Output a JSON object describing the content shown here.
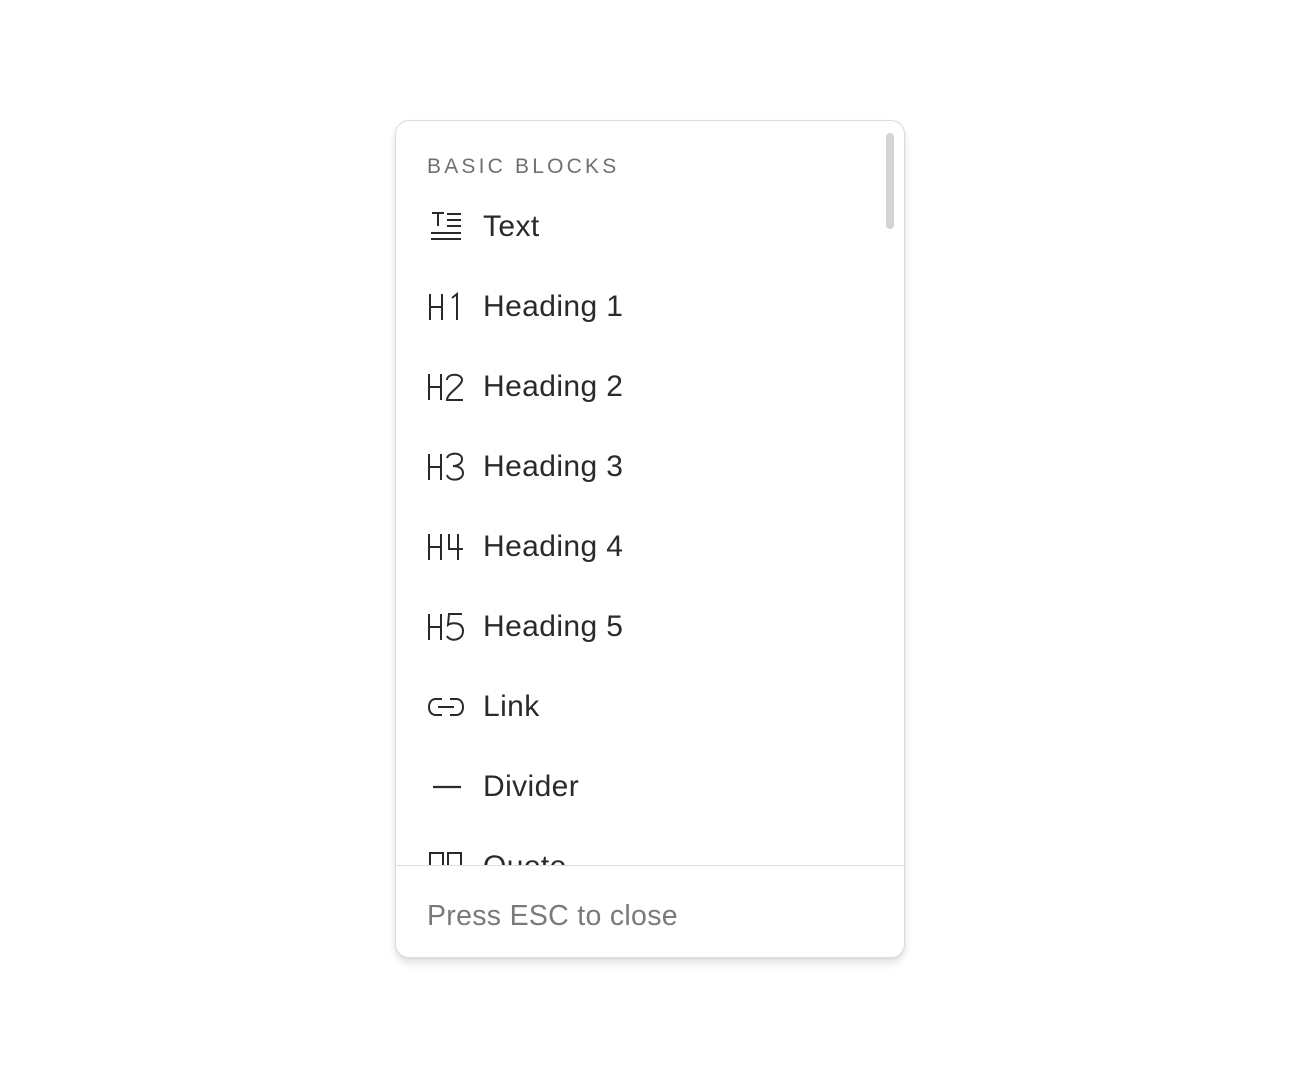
{
  "menu": {
    "section_header": "BASIC BLOCKS",
    "items": [
      {
        "label": "Text",
        "icon": "text-icon"
      },
      {
        "label": "Heading 1",
        "icon": "heading-1-icon"
      },
      {
        "label": "Heading 2",
        "icon": "heading-2-icon"
      },
      {
        "label": "Heading 3",
        "icon": "heading-3-icon"
      },
      {
        "label": "Heading 4",
        "icon": "heading-4-icon"
      },
      {
        "label": "Heading 5",
        "icon": "heading-5-icon"
      },
      {
        "label": "Link",
        "icon": "link-icon"
      },
      {
        "label": "Divider",
        "icon": "divider-icon"
      },
      {
        "label": "Quote",
        "icon": "quote-icon"
      }
    ],
    "footer_hint": "Press ESC to close"
  },
  "colors": {
    "text": "#2a2a2a",
    "muted": "#707070",
    "border": "#dcdcdc",
    "scrollbar": "#d4d4d4"
  }
}
